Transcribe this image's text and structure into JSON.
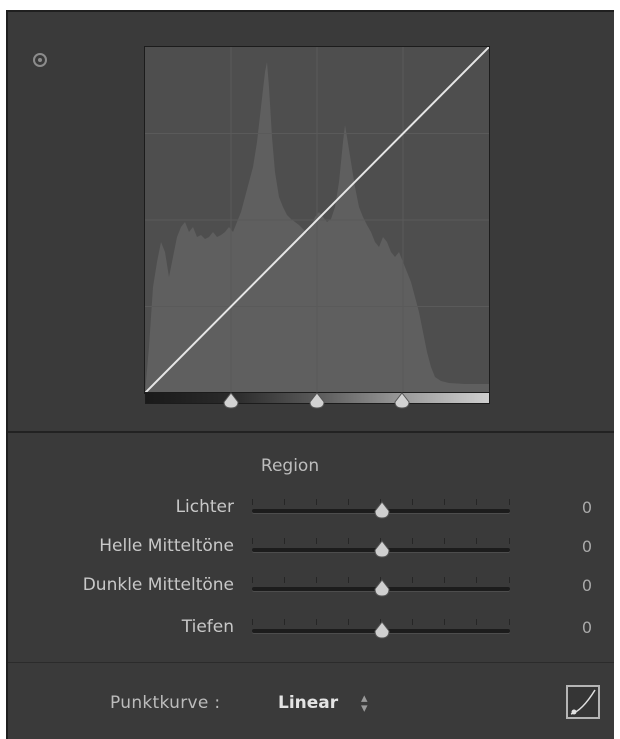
{
  "panel": {
    "target_adjustment_icon": "target-icon"
  },
  "tone_curve": {
    "curve_type": "linear",
    "split_handles": 3
  },
  "region": {
    "title": "Region",
    "sliders": [
      {
        "label": "Lichter",
        "value": "0"
      },
      {
        "label": "Helle Mitteltöne",
        "value": "0"
      },
      {
        "label": "Dunkle Mitteltöne",
        "value": "0"
      },
      {
        "label": "Tiefen",
        "value": "0"
      }
    ]
  },
  "point_curve": {
    "label": "Punktkurve :",
    "value": "Linear",
    "dropdown_icon": "up-down-arrows-icon",
    "edit_icon": "point-curve-edit-icon"
  },
  "colors": {
    "panel_bg": "#3a3a3a",
    "curve_bg": "#505050",
    "histogram": "#5e5e5e",
    "curve_line": "#e6e6e6",
    "text": "#c8c8c8"
  }
}
